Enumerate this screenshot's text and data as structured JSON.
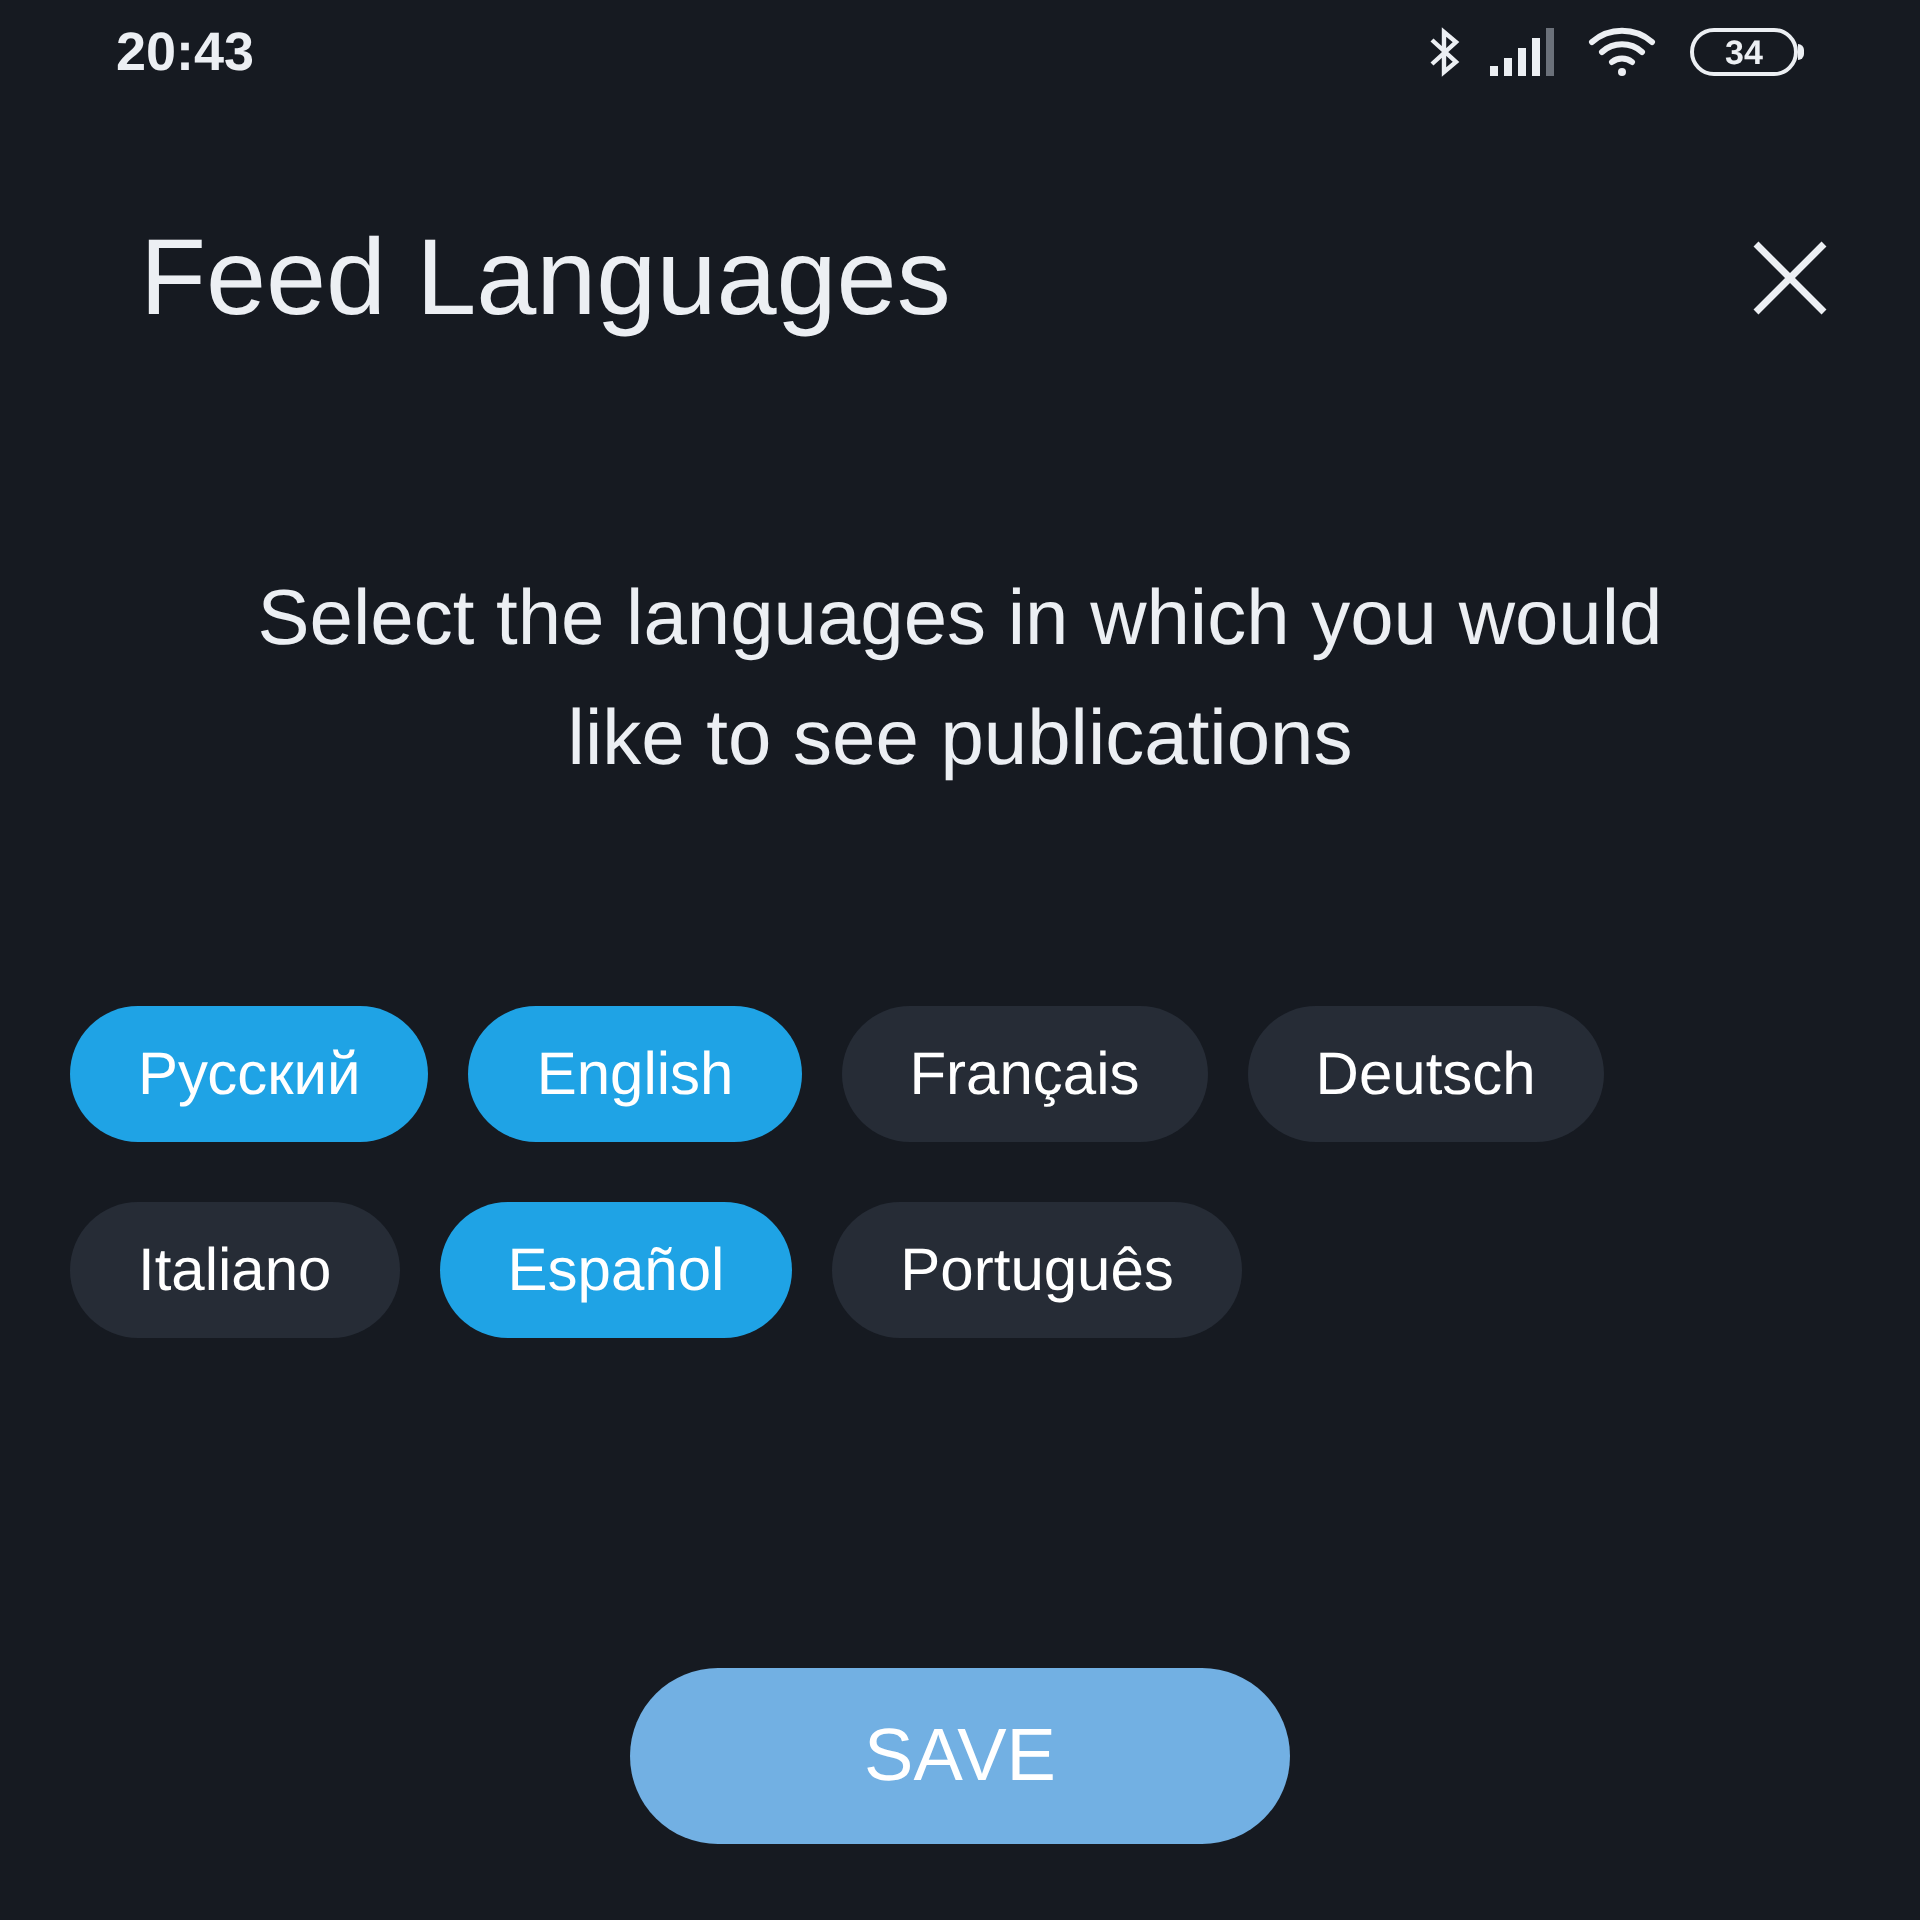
{
  "status_bar": {
    "time": "20:43",
    "battery": "34"
  },
  "title": "Feed Languages",
  "subtitle": "Select the languages in which you would like to see publications",
  "languages": [
    {
      "label": "Русский",
      "selected": true
    },
    {
      "label": "English",
      "selected": true
    },
    {
      "label": "Français",
      "selected": false
    },
    {
      "label": "Deutsch",
      "selected": false
    },
    {
      "label": "Italiano",
      "selected": false
    },
    {
      "label": "Español",
      "selected": true
    },
    {
      "label": "Português",
      "selected": false
    }
  ],
  "save_button": "SAVE"
}
